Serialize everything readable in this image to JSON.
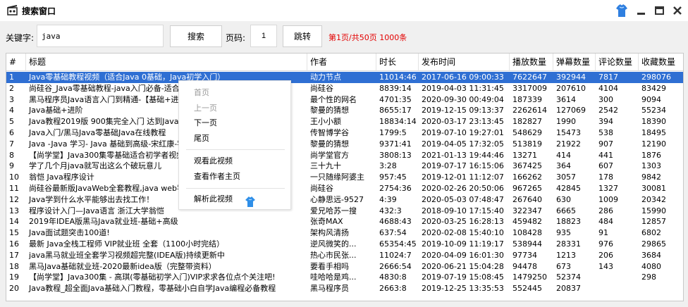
{
  "window": {
    "title": "搜索窗口",
    "accent": "#2f6fd3",
    "status_color": "#e30000"
  },
  "icons": {
    "app": "film-clapper-icon",
    "skin": "skin-shirt-icon",
    "minimize": "minimize-icon",
    "maximize": "maximize-icon",
    "close": "close-icon"
  },
  "search": {
    "label": "关键字:",
    "value": "java",
    "button": "搜索"
  },
  "pager": {
    "label": "页码:",
    "value": "1",
    "button": "跳转",
    "status": "第1页/共50页 1000条"
  },
  "table": {
    "headers": [
      "#",
      "标题",
      "作者",
      "时长",
      "发布时间",
      "播放数量",
      "弹幕数量",
      "评论数量",
      "收藏数量"
    ],
    "rows": [
      [
        "1",
        "Java零基础教程视频（适合Java 0基础，Java初学入门）",
        "动力节点",
        "11014:46",
        "2017-06-16 09:00:33",
        "7622647",
        "392944",
        "7817",
        "298076"
      ],
      [
        "2",
        "尚硅谷_Java零基础教程-java入门必备-适合初学者的全套完整版教程...",
        "尚硅谷",
        "8839:14",
        "2019-04-03 11:31:45",
        "3317009",
        "207610",
        "4104",
        "83429"
      ],
      [
        "3",
        "黑马程序员Java语言入门到精通-【基础+进阶完整版 IDEA版）",
        "最个性的网名",
        "4701:35",
        "2020-09-30 00:49:04",
        "187339",
        "3614",
        "300",
        "9094"
      ],
      [
        "4",
        "Java基础+进阶",
        "黎曼的猜想",
        "8655:17",
        "2019-12-15 09:13:37",
        "2262614",
        "127069",
        "2542",
        "55234"
      ],
      [
        "5",
        "Java教程2019版 900集完全入门 达到Java工程师水平",
        "王小小额",
        "18834:14",
        "2020-03-17 23:13:45",
        "182827",
        "1990",
        "394",
        "18390"
      ],
      [
        "6",
        "Java入门/黑马Java零基础Java在线教程",
        "传智博学谷",
        "1799:5",
        "2019-07-10 19:27:01",
        "548629",
        "15473",
        "538",
        "18495"
      ],
      [
        "7",
        "Java -Java 学习- Java 基础到高级-宋红康-零基础自学Java-尚硅谷",
        "黎曼的猜想",
        "9371:41",
        "2019-04-05 17:32:05",
        "513819",
        "21922",
        "907",
        "12190"
      ],
      [
        "8",
        "【尚学堂】Java300集零基础适合初学者视频教程",
        "尚学堂官方",
        "3808:13",
        "2021-01-13 19:44:46",
        "13271",
        "414",
        "441",
        "1876"
      ],
      [
        "9",
        "学了几个月java就写出这么个破玩意儿",
        "三十九十",
        "3:28",
        "2019-07-17 16:15:06",
        "367425",
        "364",
        "607",
        "1303"
      ],
      [
        "10",
        "翁恺  Java程序设计",
        "一只随缘阿婆主",
        "957:45",
        "2019-12-01 11:12:07",
        "166262",
        "3057",
        "178",
        "9842"
      ],
      [
        "11",
        "尚硅谷最新版JavaWeb全套教程,java web零基础入门完整版",
        "尚硅谷",
        "2754:36",
        "2020-02-26 20:50:06",
        "967265",
        "42845",
        "1327",
        "30081"
      ],
      [
        "12",
        "Java学到什么水平能够出去找工作！",
        "心静思远-9527",
        "4:39",
        "2020-05-03 07:48:47",
        "267640",
        "630",
        "1009",
        "20342"
      ],
      [
        "13",
        "程序设计入门—Java语言 浙江大学翁恺",
        "爱兄哈苏一搜",
        "432:3",
        "2018-09-10 17:15:40",
        "322347",
        "6665",
        "286",
        "15990"
      ],
      [
        "14",
        "2019年IDEA版黑马Java就业班-基础+高级",
        "张奇MAX",
        "4688:43",
        "2020-03-25 16:28:13",
        "459482",
        "18823",
        "484",
        "12857"
      ],
      [
        "15",
        "Java面试题突击100道!",
        "架构风清扬",
        "637:54",
        "2020-02-08 15:40:10",
        "108428",
        "935",
        "91",
        "6802"
      ],
      [
        "16",
        "最新 Java全栈工程师 VIP就业班 全套（1100小时完结）",
        "逆风微笑的...",
        "65354:45",
        "2019-10-09 11:19:17",
        "538944",
        "28331",
        "976",
        "29865"
      ],
      [
        "17",
        "java黑马就业班全套学习视频超完整(IDEA版)持续更新中",
        "热心市民张...",
        "11024:7",
        "2020-04-09 16:01:30",
        "97734",
        "1213",
        "206",
        "3684"
      ],
      [
        "18",
        "黑马Java基础就业班-2020最新idea版（完整带资料）",
        "要看手相吗",
        "2666:54",
        "2020-06-21 15:04:28",
        "94478",
        "673",
        "143",
        "4080"
      ],
      [
        "19",
        "【尚学堂】Java300集 - 高琪(零基础初学入门)VIP求求各位点个关注吧!",
        "哇哈哈是鸡...",
        "4830:8",
        "2019-07-19 15:08:45",
        "1479250",
        "52374",
        "",
        "298"
      ],
      [
        "20",
        "Java教程_超全面Java基础入门教程，零基础小白自学Java编程必备教程",
        "黑马程序员",
        "2663:8",
        "2019-12-25 13:35:53",
        "552445",
        "20837",
        "",
        ""
      ]
    ]
  },
  "context_menu": {
    "items": [
      "首页",
      "上一页",
      "下一页",
      "尾页",
      "观看此视频",
      "查看作者主页",
      "解析此视频"
    ],
    "disabled": [
      true,
      true,
      false,
      false,
      false,
      false,
      false
    ],
    "parse_icon": "skin-shirt-icon"
  }
}
